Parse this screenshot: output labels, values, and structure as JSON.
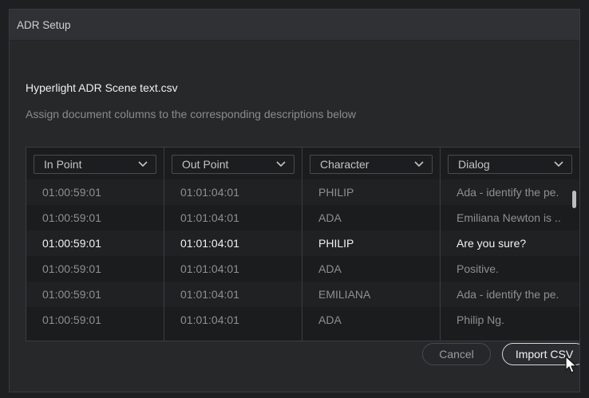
{
  "window": {
    "title": "ADR Setup"
  },
  "file": {
    "name": "Hyperlight ADR Scene text.csv"
  },
  "instructions": "Assign document columns to the corresponding descriptions below",
  "columns": [
    {
      "label": "In Point"
    },
    {
      "label": "Out Point"
    },
    {
      "label": "Character"
    },
    {
      "label": "Dialog"
    }
  ],
  "rows": [
    [
      "01:00:59:01",
      "01:01:04:01",
      "PHILIP",
      "Ada - identify the pe."
    ],
    [
      "01:00:59:01",
      "01:01:04:01",
      "ADA",
      "Emiliana Newton is .."
    ],
    [
      "01:00:59:01",
      "01:01:04:01",
      "PHILIP",
      "Are you sure?"
    ],
    [
      "01:00:59:01",
      "01:01:04:01",
      "ADA",
      "Positive."
    ],
    [
      "01:00:59:01",
      "01:01:04:01",
      "EMILIANA",
      "Ada - identify the pe."
    ],
    [
      "01:00:59:01",
      "01:01:04:01",
      "ADA",
      "Philip Ng."
    ]
  ],
  "highlighted_row": 2,
  "buttons": {
    "cancel": "Cancel",
    "import": "Import CSV"
  },
  "icons": {
    "dropdown": "chevron-down-icon",
    "cursor": "mouse-pointer-icon"
  },
  "colors": {
    "background": "#27282a",
    "table": "#1b1c1d",
    "highlight_text": "#f2f2f2"
  }
}
